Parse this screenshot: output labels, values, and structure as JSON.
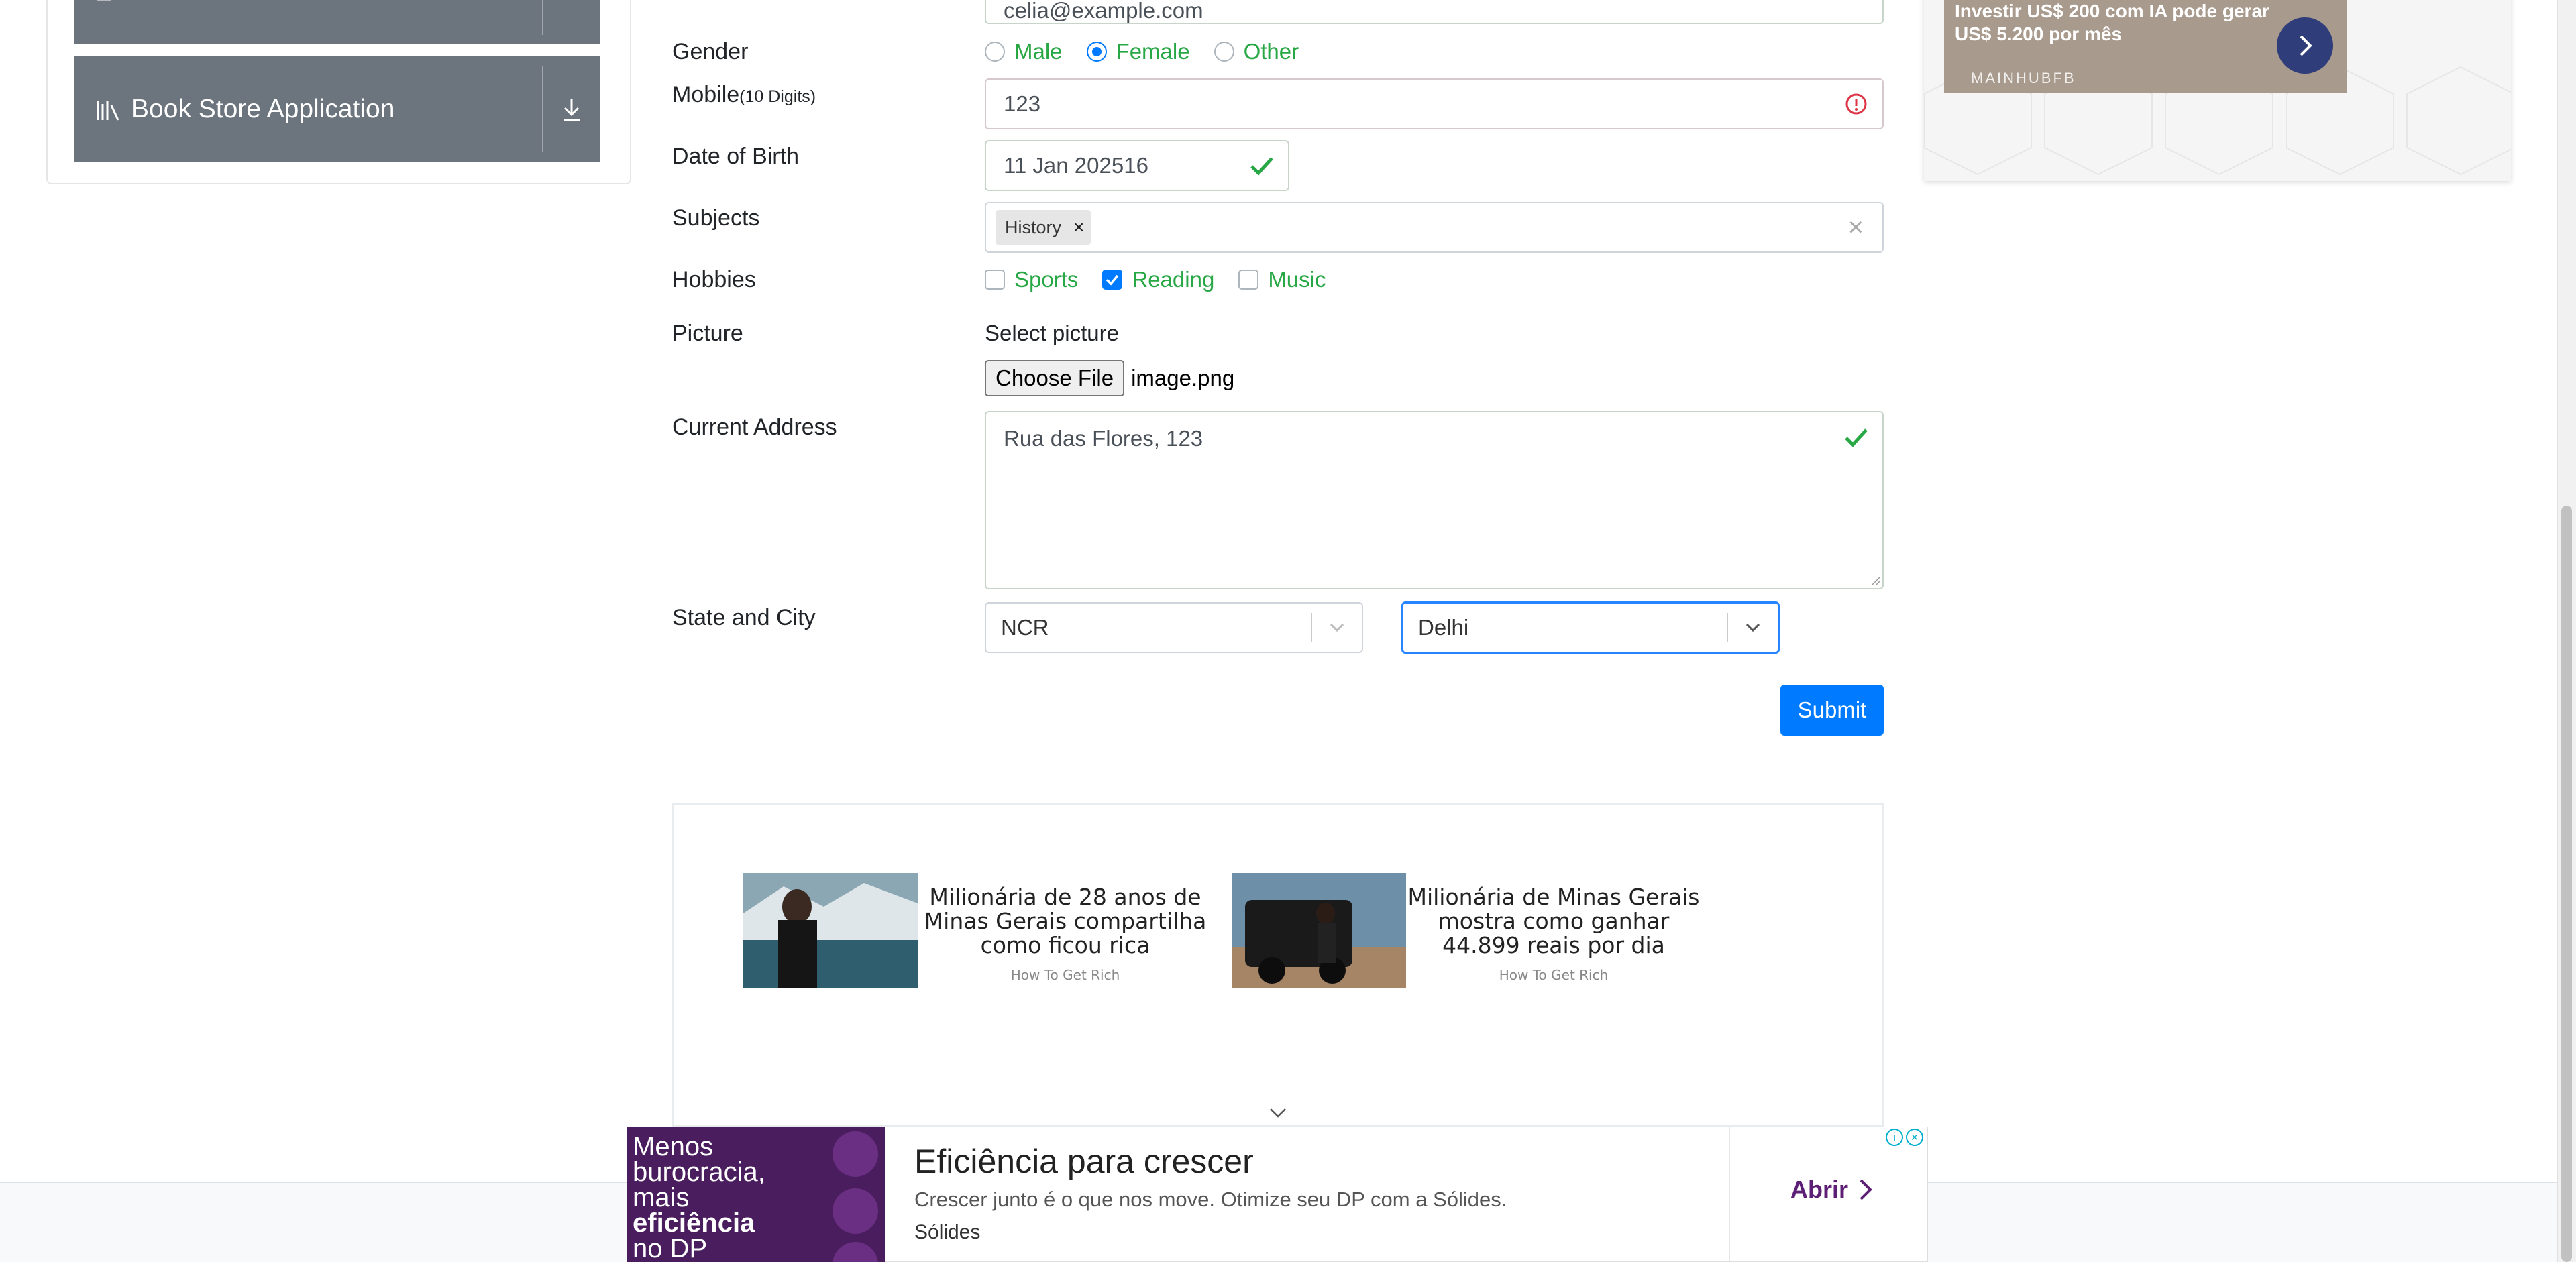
{
  "sidebar": {
    "book_store_label": "Book Store Application"
  },
  "form": {
    "email_value": "celia@example.com",
    "gender": {
      "label": "Gender",
      "options": [
        "Male",
        "Female",
        "Other"
      ],
      "selected": "Female"
    },
    "mobile": {
      "label": "Mobile",
      "hint": "(10 Digits)",
      "value": "123"
    },
    "dob": {
      "label": "Date of Birth",
      "value": "11 Jan 202516"
    },
    "subjects": {
      "label": "Subjects",
      "chips": [
        "History"
      ]
    },
    "hobbies": {
      "label": "Hobbies",
      "options": [
        "Sports",
        "Reading",
        "Music"
      ],
      "checked": [
        "Reading"
      ]
    },
    "picture": {
      "label": "Picture",
      "select_text": "Select picture",
      "button": "Choose File",
      "filename": "image.png"
    },
    "address": {
      "label": "Current Address",
      "value": "Rua das Flores, 123"
    },
    "state_city": {
      "label": "State and City",
      "state": "NCR",
      "city": "Delhi"
    },
    "submit": "Submit"
  },
  "ads": {
    "top_right": {
      "text": "Investir US$ 200 com IA pode gerar US$ 5.200 por mês",
      "brand": "MAINHUBFB"
    },
    "cards": [
      {
        "title": "Milionária de 28 anos de Minas Gerais compartilha como ficou rica",
        "source": "How To Get Rich"
      },
      {
        "title": "Milionária de Minas Gerais mostra como ganhar 44.899 reais por dia",
        "source": "How To Get Rich"
      }
    ],
    "banner": {
      "left_text_1": "Menos",
      "left_text_2": "burocracia,",
      "left_text_3": "mais",
      "left_text_4": "eficiência",
      "left_text_5": "no DP",
      "title": "Eficiência para crescer",
      "desc": "Crescer junto é o que nos move. Otimize seu DP com a Sólides.",
      "brand": "Sólides",
      "cta": "Abrir"
    }
  },
  "colors": {
    "primary": "#007bff",
    "valid_green": "#28a745",
    "invalid_red": "#dc3545",
    "sidebar_btn": "#6c757d"
  }
}
